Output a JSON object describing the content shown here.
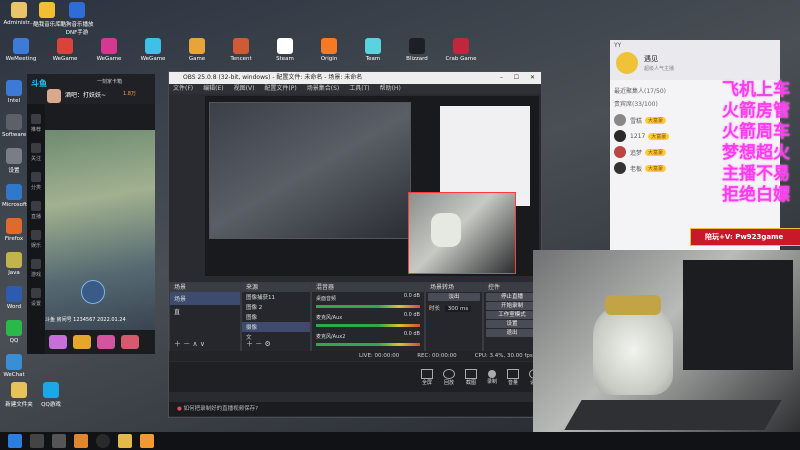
{
  "desktop": {
    "icons_row1": [
      "Administr...",
      "酷我音乐库",
      "酷狗音乐播放 DNF手游"
    ],
    "icons_row2": [
      "WeMeeting",
      "WeGame",
      "WeGame",
      "WeGame",
      "Game",
      "Tencent",
      "Steam",
      "Origin",
      "Team",
      "Blizzard",
      "Crab Game"
    ],
    "icons_left": [
      "Intel",
      "Software",
      "设置",
      "Microsoft",
      "Firefox",
      "Java",
      "Word",
      "QQ",
      "WeChat",
      "新建文件夹",
      "QQ游戏"
    ]
  },
  "stream_app": {
    "name": "斗鱼",
    "room_title": "酒吧：打妖妖~",
    "streamer_badge": "1.8万",
    "side_labels": [
      "推荐",
      "关注",
      "分类",
      "直播",
      "娱乐",
      "游戏",
      "设置"
    ],
    "bottom_text": "斗鱼 房间号 1234567 2022.01.24",
    "tags": [
      "一刻家卡箱",
      "主播"
    ]
  },
  "obs": {
    "title": "OBS 25.0.8 (32-bit, windows) - 配置文件: 未命名 - 场景: 未命名",
    "menu": [
      "文件(F)",
      "编辑(E)",
      "视图(V)",
      "配置文件(P)",
      "场景集合(S)",
      "工具(T)",
      "帮助(H)"
    ],
    "docks": {
      "scenes": "场景",
      "sources": "来源",
      "mixer": "混音器",
      "transitions": "场景转场",
      "controls": "控件"
    },
    "scene_items": [
      "场景",
      "直"
    ],
    "source_items": [
      "图像捕获11",
      "图像 2",
      "图像",
      "摄像",
      "文"
    ],
    "mixer_items": [
      "桌面音频",
      "麦克风/Aux",
      "麦克风/Aux2"
    ],
    "mixer_values": [
      "0.0 dB",
      "0.0 dB",
      "0.0 dB"
    ],
    "transition_type": "淡出",
    "duration_label": "时长",
    "duration_value": "300 ms",
    "controls_buttons": [
      "停止直播",
      "开始录制",
      "工作室模式",
      "设置",
      "退出"
    ],
    "status": [
      "LIVE: 00:00:00",
      "REC: 00:00:00",
      "CPU: 3.4%, 30.00 fps"
    ],
    "bottom_icons": [
      "全屏",
      "回放",
      "截图",
      "录制",
      "音量",
      "设置"
    ],
    "notice": "如何把录制好的直播视频保存?"
  },
  "chat": {
    "header": "YY",
    "user": "遇见",
    "sub": "超级人气主播",
    "section_a": "最近聚集人(17/50)",
    "section_b": "贵宾席(33/100)",
    "rows": [
      {
        "name": "雪糕",
        "badge": "大富豪"
      },
      {
        "name": "1217",
        "badge": "大富豪"
      },
      {
        "name": "追梦",
        "badge": "大富豪"
      },
      {
        "name": "老板",
        "badge": "大富豪"
      }
    ],
    "banner": "陪玩+V: Pw923game"
  },
  "overlay_text": [
    "飞机上车",
    "火箭房管",
    "火箭周车",
    "梦想超火",
    "主播不易",
    "拒绝白嫖"
  ],
  "taskbar": {
    "start": "start-icon",
    "items": [
      "search-icon",
      "taskview-icon",
      "browser-icon",
      "obs-icon",
      "folder-icon",
      "app-icon"
    ]
  }
}
